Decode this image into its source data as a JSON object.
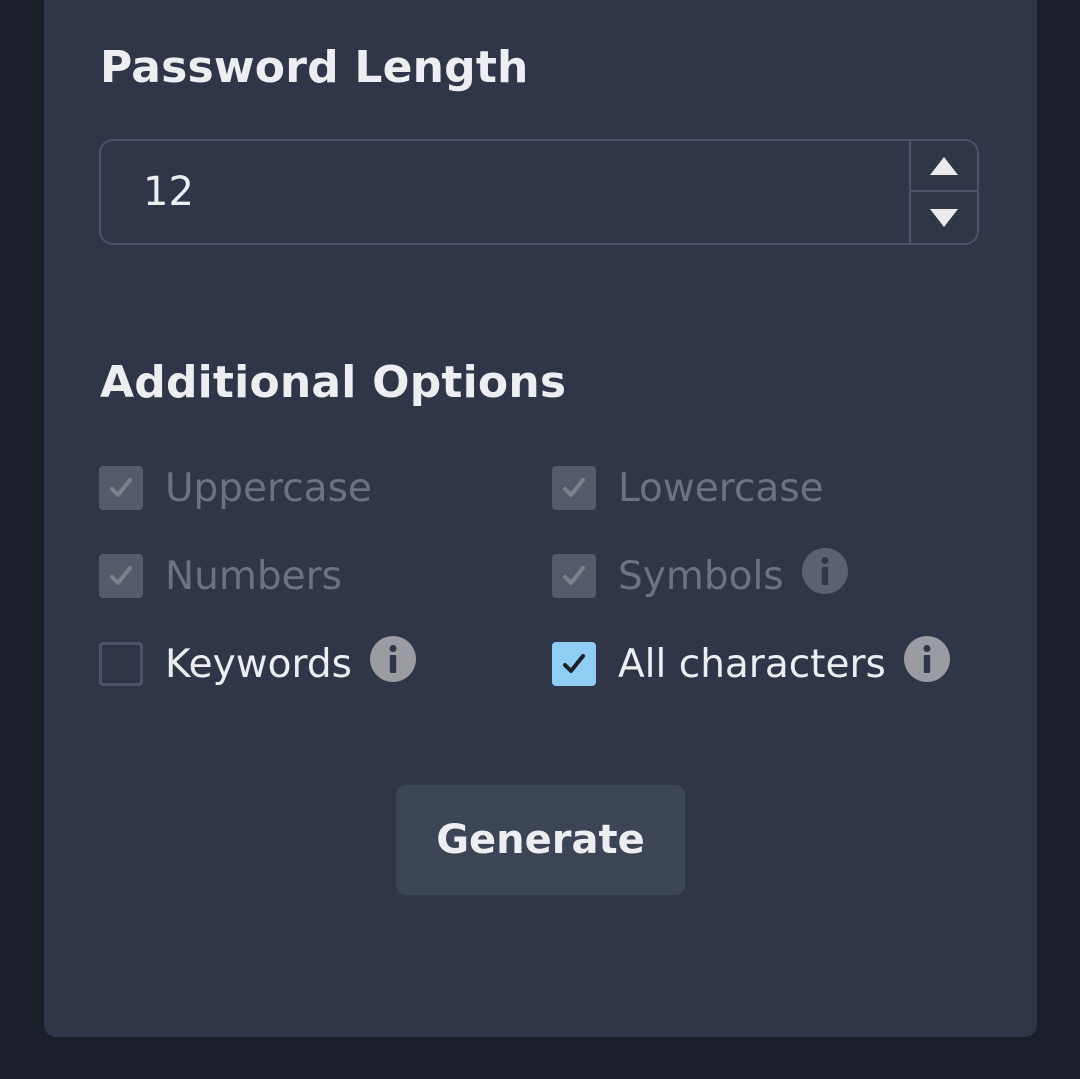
{
  "password_length": {
    "heading": "Password Length",
    "value": "12"
  },
  "options": {
    "heading": "Additional Options",
    "items": [
      {
        "label": "Uppercase",
        "checked": true,
        "disabled": true,
        "info": false
      },
      {
        "label": "Lowercase",
        "checked": true,
        "disabled": true,
        "info": false
      },
      {
        "label": "Numbers",
        "checked": true,
        "disabled": true,
        "info": false
      },
      {
        "label": "Symbols",
        "checked": true,
        "disabled": true,
        "info": true
      },
      {
        "label": "Keywords",
        "checked": false,
        "disabled": false,
        "info": true
      },
      {
        "label": "All characters",
        "checked": true,
        "disabled": false,
        "info": true
      }
    ]
  },
  "generate_button": {
    "label": "Generate"
  },
  "colors": {
    "page_background": "#1b202a",
    "card_background": "#2e3648",
    "accent": "#90cdf4",
    "button_background": "#3c4556"
  },
  "icons": {
    "step_up": "triangle-up-icon",
    "step_down": "triangle-down-icon",
    "info": "info-icon",
    "check": "check-icon"
  }
}
